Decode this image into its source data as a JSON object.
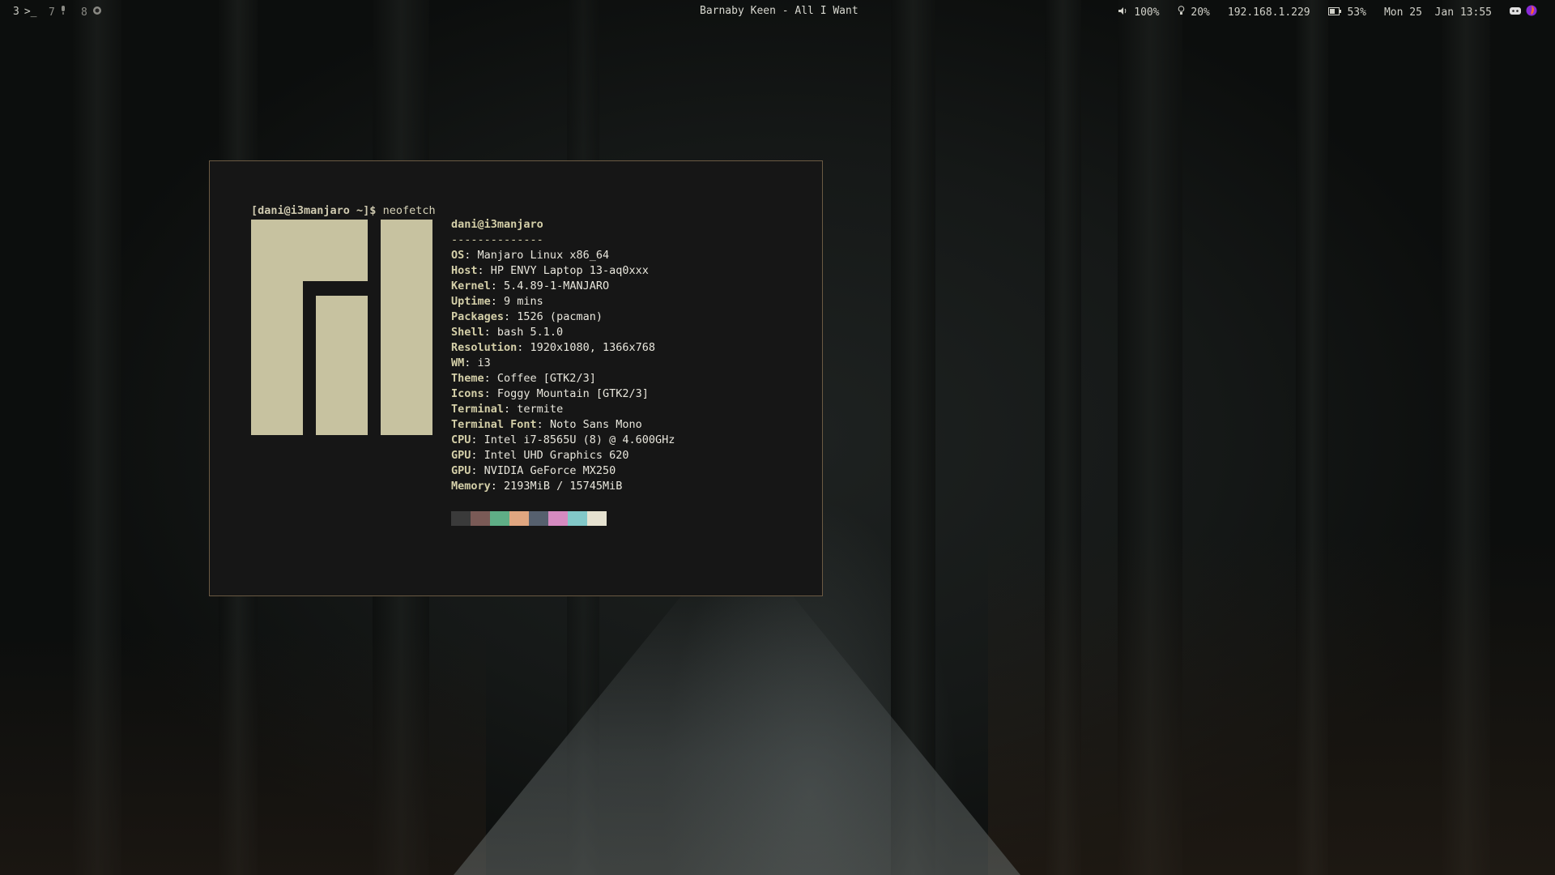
{
  "bar": {
    "workspaces": [
      {
        "num": "3",
        "icon": ">_"
      },
      {
        "num": "7",
        "icon": "mic"
      },
      {
        "num": "8",
        "icon": "circle"
      }
    ],
    "now_playing": "Barnaby Keen - All I Want",
    "volume": "100%",
    "brightness": "20%",
    "ip": "192.168.1.229",
    "battery": "53%",
    "date": "Mon 25  Jan 13:55"
  },
  "terminal": {
    "prompt_user": "[dani@i3manjaro ~]$",
    "command": "neofetch",
    "header": "dani@i3manjaro",
    "separator": "--------------",
    "info": [
      {
        "key": "OS",
        "value": "Manjaro Linux x86_64"
      },
      {
        "key": "Host",
        "value": "HP ENVY Laptop 13-aq0xxx"
      },
      {
        "key": "Kernel",
        "value": "5.4.89-1-MANJARO"
      },
      {
        "key": "Uptime",
        "value": "9 mins"
      },
      {
        "key": "Packages",
        "value": "1526 (pacman)"
      },
      {
        "key": "Shell",
        "value": "bash 5.1.0"
      },
      {
        "key": "Resolution",
        "value": "1920x1080, 1366x768"
      },
      {
        "key": "WM",
        "value": "i3"
      },
      {
        "key": "Theme",
        "value": "Coffee [GTK2/3]"
      },
      {
        "key": "Icons",
        "value": "Foggy Mountain [GTK2/3]"
      },
      {
        "key": "Terminal",
        "value": "termite"
      },
      {
        "key": "Terminal Font",
        "value": "Noto Sans Mono"
      },
      {
        "key": "CPU",
        "value": "Intel i7-8565U (8) @ 4.600GHz"
      },
      {
        "key": "GPU",
        "value": "Intel UHD Graphics 620"
      },
      {
        "key": "GPU",
        "value": "NVIDIA GeForce MX250"
      },
      {
        "key": "Memory",
        "value": "2193MiB / 15745MiB"
      }
    ],
    "palette": [
      "#3a3a3a",
      "#7a5a56",
      "#5fae86",
      "#e0a680",
      "#56606e",
      "#d58ac0",
      "#82c8c8",
      "#e6e2d0"
    ]
  },
  "colors": {
    "accent": "#c7c2a0",
    "border": "#6b5a43",
    "term_bg": "#161616"
  }
}
